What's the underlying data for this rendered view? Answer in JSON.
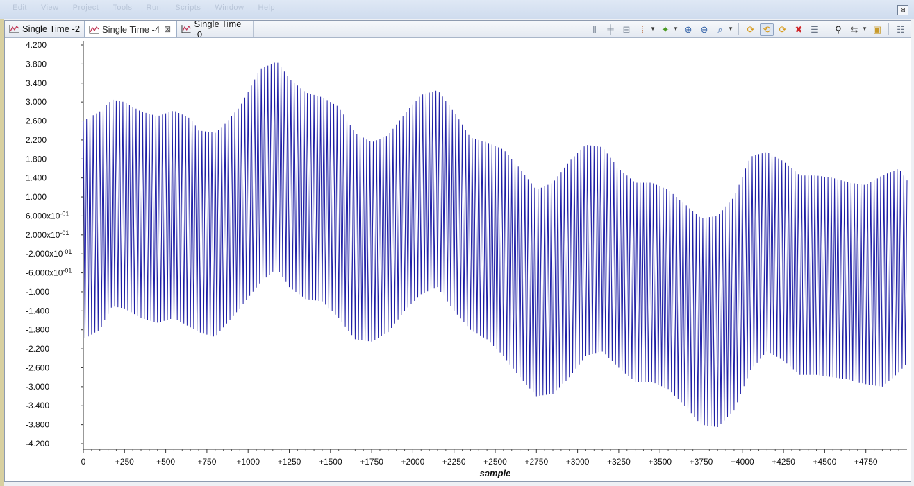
{
  "window": {
    "menu": [
      "Edit",
      "View",
      "Project",
      "Tools",
      "Run",
      "Scripts",
      "Window",
      "Help"
    ],
    "close_glyph": "⊠"
  },
  "tabs": [
    {
      "label": "Single Time -2",
      "active": false,
      "closable": false
    },
    {
      "label": "Single Time -4",
      "active": true,
      "closable": true
    },
    {
      "label": "Single Time -0",
      "active": false,
      "closable": false
    }
  ],
  "toolbar": {
    "buttons": [
      {
        "icon": "align-left-icon",
        "glyph": "⫴",
        "color": "#7b8797"
      },
      {
        "icon": "measure-icon",
        "glyph": "╪",
        "color": "#7b8797"
      },
      {
        "icon": "split-icon",
        "glyph": "⊟",
        "color": "#7b8797"
      },
      {
        "icon": "marker-icon",
        "glyph": "⁞",
        "color": "#b05a2a",
        "dropdown": true
      },
      {
        "icon": "add-graph-icon",
        "glyph": "✦",
        "color": "#4a9a22",
        "dropdown": true
      },
      {
        "icon": "zoom-in-icon",
        "glyph": "⊕",
        "color": "#2f5fa6"
      },
      {
        "icon": "zoom-out-icon",
        "glyph": "⊖",
        "color": "#2f5fa6"
      },
      {
        "icon": "zoom-fit-icon",
        "glyph": "⌕",
        "color": "#2f5fa6",
        "dropdown": true
      },
      {
        "icon": "refresh-icon",
        "glyph": "⟳",
        "color": "#d89a1a",
        "separator_before": true
      },
      {
        "icon": "continuous-refresh-icon",
        "glyph": "⟲",
        "color": "#d89a1a",
        "pressed": true
      },
      {
        "icon": "auto-refresh-icon",
        "glyph": "⟳",
        "color": "#d89a1a"
      },
      {
        "icon": "delete-icon",
        "glyph": "✖",
        "color": "#d0262a"
      },
      {
        "icon": "properties-icon",
        "glyph": "☰",
        "color": "#6b7687"
      },
      {
        "icon": "find-icon",
        "glyph": "⚲",
        "color": "#222222",
        "separator_before": true
      },
      {
        "icon": "import-export-icon",
        "glyph": "⇆",
        "color": "#555555",
        "dropdown": true
      },
      {
        "icon": "save-icon",
        "glyph": "▣",
        "color": "#c89a2a"
      },
      {
        "icon": "menu-icon",
        "glyph": "☷",
        "color": "#6b7687",
        "separator_before": true
      }
    ]
  },
  "chart_data": {
    "type": "line",
    "xlabel": "sample",
    "ylabel": "",
    "xlim": [
      0,
      5000
    ],
    "ylim": [
      -4.2,
      4.2
    ],
    "x_tick_labels": [
      "0",
      "+250",
      "+500",
      "+750",
      "+1000",
      "+1250",
      "+1500",
      "+1750",
      "+2000",
      "+2250",
      "+2500",
      "+2750",
      "+3000",
      "+3250",
      "+3500",
      "+3750",
      "+4000",
      "+4250",
      "+4500",
      "+4750"
    ],
    "y_tick_labels": [
      "4.200",
      "3.800",
      "3.400",
      "3.000",
      "2.600",
      "2.200",
      "1.800",
      "1.400",
      "1.000",
      "6.000x10-01",
      "2.000x10-01",
      "-2.000x10-01",
      "-6.000x10-01",
      "-1.000",
      "-1.400",
      "-1.800",
      "-2.200",
      "-2.600",
      "-3.000",
      "-3.400",
      "-3.800",
      "-4.200"
    ],
    "y_tick_values": [
      4.2,
      3.8,
      3.4,
      3.0,
      2.6,
      2.2,
      1.8,
      1.4,
      1.0,
      0.6,
      0.2,
      -0.2,
      -0.6,
      -1.0,
      -1.4,
      -1.8,
      -2.2,
      -2.6,
      -3.0,
      -3.4,
      -3.8,
      -4.2
    ],
    "series": [
      {
        "color": "#1f1fa6",
        "oscillation_period_samples": 20,
        "envelope": {
          "x": [
            0,
            100,
            175,
            250,
            350,
            450,
            550,
            650,
            700,
            800,
            850,
            950,
            1075,
            1175,
            1250,
            1350,
            1450,
            1550,
            1650,
            1750,
            1850,
            1950,
            2050,
            2150,
            2250,
            2350,
            2450,
            2550,
            2650,
            2750,
            2850,
            2950,
            3050,
            3150,
            3250,
            3350,
            3450,
            3550,
            3650,
            3750,
            3850,
            3950,
            4050,
            4150,
            4250,
            4350,
            4450,
            4550,
            4650,
            4750,
            4850,
            4950,
            5000
          ],
          "upper": [
            2.6,
            2.8,
            3.05,
            3.0,
            2.8,
            2.7,
            2.82,
            2.65,
            2.4,
            2.35,
            2.5,
            2.9,
            3.7,
            3.85,
            3.5,
            3.2,
            3.1,
            2.9,
            2.35,
            2.15,
            2.3,
            2.75,
            3.15,
            3.25,
            2.8,
            2.25,
            2.15,
            2.0,
            1.6,
            1.15,
            1.3,
            1.75,
            2.1,
            2.05,
            1.6,
            1.3,
            1.3,
            1.15,
            0.85,
            0.55,
            0.6,
            1.0,
            1.85,
            1.95,
            1.75,
            1.45,
            1.45,
            1.4,
            1.3,
            1.25,
            1.45,
            1.6,
            1.35
          ],
          "lower": [
            -2.0,
            -1.8,
            -1.3,
            -1.35,
            -1.55,
            -1.65,
            -1.55,
            -1.75,
            -1.85,
            -1.95,
            -1.75,
            -1.35,
            -0.8,
            -0.5,
            -0.9,
            -1.15,
            -1.2,
            -1.55,
            -2.0,
            -2.05,
            -1.85,
            -1.4,
            -1.05,
            -0.9,
            -1.4,
            -1.8,
            -2.0,
            -2.35,
            -2.8,
            -3.2,
            -3.15,
            -2.8,
            -2.35,
            -2.25,
            -2.6,
            -2.9,
            -2.9,
            -3.05,
            -3.4,
            -3.8,
            -3.85,
            -3.5,
            -2.65,
            -2.25,
            -2.45,
            -2.75,
            -2.75,
            -2.8,
            -2.85,
            -2.95,
            -3.0,
            -2.7,
            -2.5
          ]
        }
      }
    ]
  }
}
